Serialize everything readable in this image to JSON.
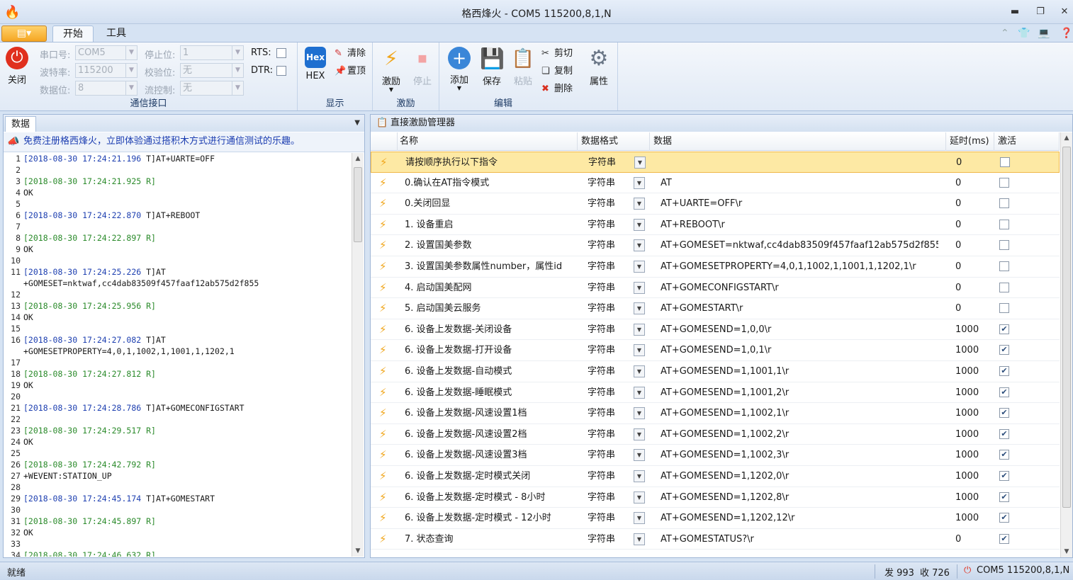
{
  "window": {
    "title": "格西烽火 - COM5  115200,8,1,N"
  },
  "ribbon_tabs": [
    "开始",
    "工具"
  ],
  "comm": {
    "group_label": "通信接口",
    "close_label": "关闭",
    "port_label": "串口号:",
    "port_value": "COM5",
    "baud_label": "波特率:",
    "baud_value": "115200",
    "data_label": "数据位:",
    "data_value": "8",
    "stop_label": "停止位:",
    "stop_value": "1",
    "parity_label": "校验位:",
    "parity_value": "无",
    "flow_label": "流控制:",
    "flow_value": "无",
    "rts_label": "RTS:",
    "dtr_label": "DTR:"
  },
  "display": {
    "group_label": "显示",
    "hex_icon": "Hex",
    "hex_label": "HEX",
    "clear_label": "清除",
    "top_label": "置顶"
  },
  "stimulus": {
    "group_label": "激励",
    "excite_label": "激励",
    "stop_label": "停止"
  },
  "edit": {
    "group_label": "编辑",
    "add_label": "添加",
    "save_label": "保存",
    "paste_label": "粘贴",
    "cut_label": "剪切",
    "copy_label": "复制",
    "delete_label": "删除",
    "props_label": "属性"
  },
  "left_panel": {
    "tab_label": "数据",
    "notice": "免费注册格西烽火，立即体验通过搭积木方式进行通信测试的乐趣。",
    "log": [
      {
        "n": "1",
        "ts": "[2018-08-30 17:24:21.196 ",
        "rest": "T]AT+UARTE=OFF",
        "k": "t"
      },
      {
        "n": "2",
        "ts": "",
        "rest": "",
        "k": ""
      },
      {
        "n": "3",
        "ts": "[2018-08-30 17:24:21.925 R]",
        "rest": "",
        "k": "r"
      },
      {
        "n": "4",
        "ts": "",
        "rest": "OK",
        "k": ""
      },
      {
        "n": "5",
        "ts": "",
        "rest": "",
        "k": ""
      },
      {
        "n": "6",
        "ts": "[2018-08-30 17:24:22.870 ",
        "rest": "T]AT+REBOOT",
        "k": "t"
      },
      {
        "n": "7",
        "ts": "",
        "rest": "",
        "k": ""
      },
      {
        "n": "8",
        "ts": "[2018-08-30 17:24:22.897 R]",
        "rest": "",
        "k": "r"
      },
      {
        "n": "9",
        "ts": "",
        "rest": "OK",
        "k": ""
      },
      {
        "n": "10",
        "ts": "",
        "rest": "",
        "k": ""
      },
      {
        "n": "11",
        "ts": "[2018-08-30 17:24:25.226 ",
        "rest": "T]AT",
        "k": "t"
      },
      {
        "n": "",
        "ts": "",
        "rest": "+GOMESET=nktwaf,cc4dab83509f457faaf12ab575d2f855",
        "k": ""
      },
      {
        "n": "12",
        "ts": "",
        "rest": "",
        "k": ""
      },
      {
        "n": "13",
        "ts": "[2018-08-30 17:24:25.956 R]",
        "rest": "",
        "k": "r"
      },
      {
        "n": "14",
        "ts": "",
        "rest": "OK",
        "k": ""
      },
      {
        "n": "15",
        "ts": "",
        "rest": "",
        "k": ""
      },
      {
        "n": "16",
        "ts": "[2018-08-30 17:24:27.082 ",
        "rest": "T]AT",
        "k": "t"
      },
      {
        "n": "",
        "ts": "",
        "rest": "+GOMESETPROPERTY=4,0,1,1002,1,1001,1,1202,1",
        "k": ""
      },
      {
        "n": "17",
        "ts": "",
        "rest": "",
        "k": ""
      },
      {
        "n": "18",
        "ts": "[2018-08-30 17:24:27.812 R]",
        "rest": "",
        "k": "r"
      },
      {
        "n": "19",
        "ts": "",
        "rest": "OK",
        "k": ""
      },
      {
        "n": "20",
        "ts": "",
        "rest": "",
        "k": ""
      },
      {
        "n": "21",
        "ts": "[2018-08-30 17:24:28.786 ",
        "rest": "T]AT+GOMECONFIGSTART",
        "k": "t"
      },
      {
        "n": "22",
        "ts": "",
        "rest": "",
        "k": ""
      },
      {
        "n": "23",
        "ts": "[2018-08-30 17:24:29.517 R]",
        "rest": "",
        "k": "r"
      },
      {
        "n": "24",
        "ts": "",
        "rest": "OK",
        "k": ""
      },
      {
        "n": "25",
        "ts": "",
        "rest": "",
        "k": ""
      },
      {
        "n": "26",
        "ts": "[2018-08-30 17:24:42.792 R]",
        "rest": "",
        "k": "r"
      },
      {
        "n": "27",
        "ts": "",
        "rest": "+WEVENT:STATION_UP",
        "k": ""
      },
      {
        "n": "28",
        "ts": "",
        "rest": "",
        "k": ""
      },
      {
        "n": "29",
        "ts": "[2018-08-30 17:24:45.174 ",
        "rest": "T]AT+GOMESTART",
        "k": "t"
      },
      {
        "n": "30",
        "ts": "",
        "rest": "",
        "k": ""
      },
      {
        "n": "31",
        "ts": "[2018-08-30 17:24:45.897 R]",
        "rest": "",
        "k": "r"
      },
      {
        "n": "32",
        "ts": "",
        "rest": "OK",
        "k": ""
      },
      {
        "n": "33",
        "ts": "",
        "rest": "",
        "k": ""
      },
      {
        "n": "34",
        "ts": "[2018-08-30 17:24:46.632 R]",
        "rest": "",
        "k": "r"
      }
    ]
  },
  "right_panel": {
    "title": "直接激励管理器",
    "columns": {
      "name": "名称",
      "format": "数据格式",
      "data": "数据",
      "delay": "延时(ms)",
      "active": "激活"
    },
    "rows": [
      {
        "name": "请按顺序执行以下指令",
        "format": "字符串",
        "data": "",
        "delay": "0",
        "active": false
      },
      {
        "name": "0.确认在AT指令模式",
        "format": "字符串",
        "data": "AT",
        "delay": "0",
        "active": false
      },
      {
        "name": "0.关闭回显",
        "format": "字符串",
        "data": "AT+UARTE=OFF\\r",
        "delay": "0",
        "active": false
      },
      {
        "name": "1. 设备重启",
        "format": "字符串",
        "data": "AT+REBOOT\\r",
        "delay": "0",
        "active": false
      },
      {
        "name": "2. 设置国美参数",
        "format": "字符串",
        "data": "AT+GOMESET=nktwaf,cc4dab83509f457faaf12ab575d2f855",
        "delay": "0",
        "active": false
      },
      {
        "name": "3. 设置国美参数属性number，属性id",
        "format": "字符串",
        "data": "AT+GOMESETPROPERTY=4,0,1,1002,1,1001,1,1202,1\\r",
        "delay": "0",
        "active": false
      },
      {
        "name": "4. 启动国美配网",
        "format": "字符串",
        "data": "AT+GOMECONFIGSTART\\r",
        "delay": "0",
        "active": false
      },
      {
        "name": "5. 启动国美云服务",
        "format": "字符串",
        "data": "AT+GOMESTART\\r",
        "delay": "0",
        "active": false
      },
      {
        "name": "6. 设备上发数据-关闭设备",
        "format": "字符串",
        "data": "AT+GOMESEND=1,0,0\\r",
        "delay": "1000",
        "active": true
      },
      {
        "name": "6. 设备上发数据-打开设备",
        "format": "字符串",
        "data": "AT+GOMESEND=1,0,1\\r",
        "delay": "1000",
        "active": true
      },
      {
        "name": "6. 设备上发数据-自动模式",
        "format": "字符串",
        "data": "AT+GOMESEND=1,1001,1\\r",
        "delay": "1000",
        "active": true
      },
      {
        "name": "6. 设备上发数据-睡眠模式",
        "format": "字符串",
        "data": "AT+GOMESEND=1,1001,2\\r",
        "delay": "1000",
        "active": true
      },
      {
        "name": "6. 设备上发数据-风速设置1档",
        "format": "字符串",
        "data": "AT+GOMESEND=1,1002,1\\r",
        "delay": "1000",
        "active": true
      },
      {
        "name": "6. 设备上发数据-风速设置2档",
        "format": "字符串",
        "data": "AT+GOMESEND=1,1002,2\\r",
        "delay": "1000",
        "active": true
      },
      {
        "name": "6. 设备上发数据-风速设置3档",
        "format": "字符串",
        "data": "AT+GOMESEND=1,1002,3\\r",
        "delay": "1000",
        "active": true
      },
      {
        "name": "6. 设备上发数据-定时模式关闭",
        "format": "字符串",
        "data": "AT+GOMESEND=1,1202,0\\r",
        "delay": "1000",
        "active": true
      },
      {
        "name": "6. 设备上发数据-定时模式 - 8小时",
        "format": "字符串",
        "data": "AT+GOMESEND=1,1202,8\\r",
        "delay": "1000",
        "active": true
      },
      {
        "name": "6. 设备上发数据-定时模式 - 12小时",
        "format": "字符串",
        "data": "AT+GOMESEND=1,1202,12\\r",
        "delay": "1000",
        "active": true
      },
      {
        "name": "7. 状态查询",
        "format": "字符串",
        "data": "AT+GOMESTATUS?\\r",
        "delay": "0",
        "active": true
      }
    ]
  },
  "status": {
    "ready": "就绪",
    "sent": "发 993",
    "recv": "收 726",
    "port": "COM5  115200,8,1,N"
  },
  "colors": {
    "accent": "#f5a623",
    "ribbon": "#e1eaf6",
    "selected_row": "#fde9a4",
    "power": "#e0301e"
  }
}
